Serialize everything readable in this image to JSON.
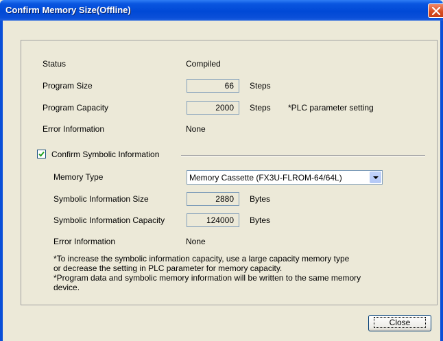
{
  "window": {
    "title": "Confirm Memory Size(Offline)"
  },
  "program": {
    "status_label": "Status",
    "status_value": "Compiled",
    "size_label": "Program Size",
    "size_value": "66",
    "size_unit": "Steps",
    "capacity_label": "Program Capacity",
    "capacity_value": "2000",
    "capacity_unit": "Steps",
    "capacity_note": "*PLC parameter setting",
    "error_label": "Error Information",
    "error_value": "None"
  },
  "symbolic": {
    "checkbox_label": "Confirm Symbolic Information",
    "checked": true,
    "memory_type_label": "Memory Type",
    "memory_type_value": "Memory Cassette (FX3U-FLROM-64/64L)",
    "size_label": "Symbolic Information Size",
    "size_value": "2880",
    "size_unit": "Bytes",
    "capacity_label": "Symbolic Information Capacity",
    "capacity_value": "124000",
    "capacity_unit": "Bytes",
    "error_label": "Error Information",
    "error_value": "None"
  },
  "notes": [
    "*To increase the symbolic information capacity, use a large capacity memory type",
    "or decrease the setting in PLC parameter for memory capacity.",
    "*Program data and symbolic memory information will be written to the same memory",
    "device."
  ],
  "buttons": {
    "close_label": "Close"
  },
  "colors": {
    "titlebar": "#0049d6",
    "dialog_bg": "#ece9d8",
    "close_red": "#d84a1e"
  }
}
